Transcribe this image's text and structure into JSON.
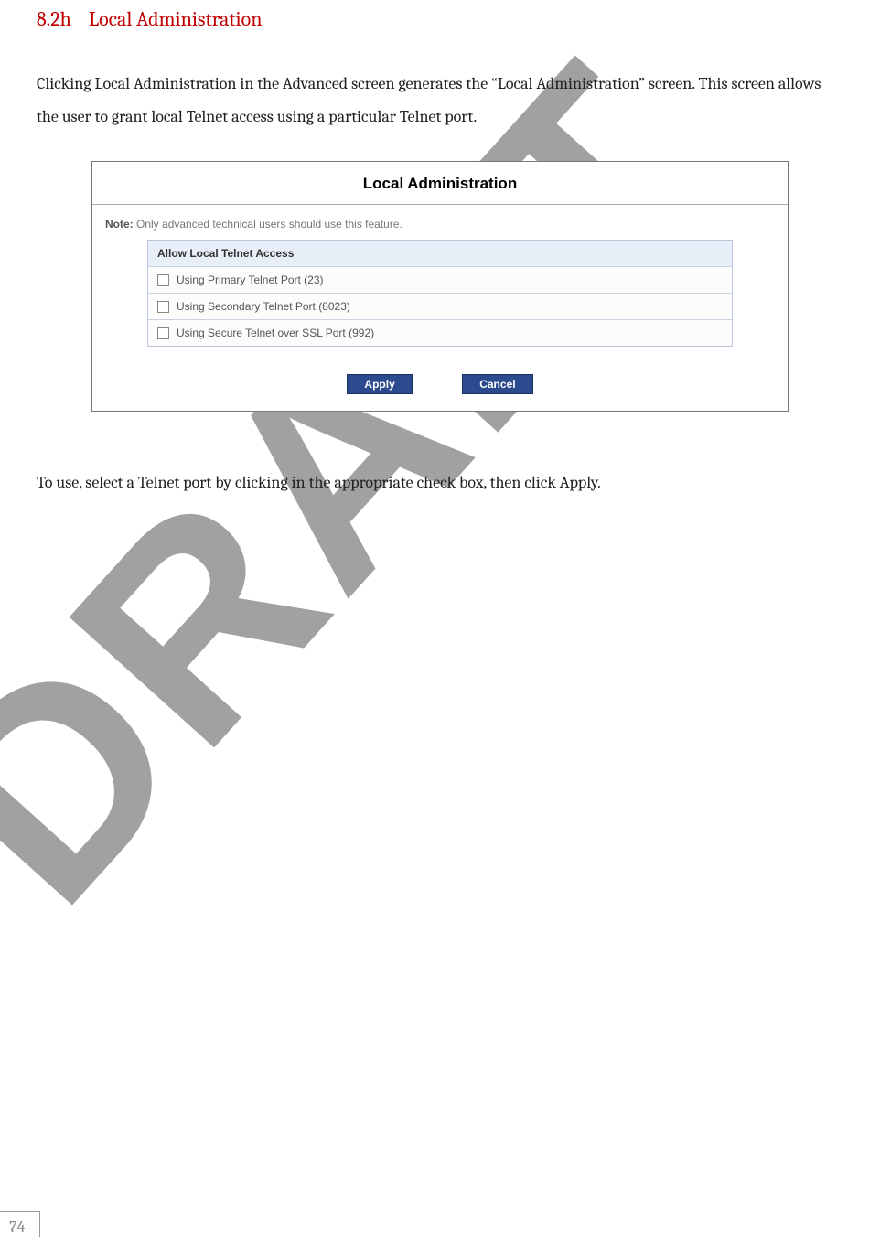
{
  "heading": {
    "number": "8.2h",
    "title": "Local Administration"
  },
  "paragraph1": "Clicking Local Administration in the Advanced screen generates the “Local Administration” screen. This screen allows the user to grant local Telnet access using a particular Telnet port.",
  "screenshot": {
    "title": "Local Administration",
    "noteLabel": "Note:",
    "noteText": " Only advanced technical users should use this feature.",
    "sectionHeader": "Allow Local Telnet Access",
    "options": [
      "Using Primary Telnet Port (23)",
      "Using Secondary Telnet Port (8023)",
      "Using Secure Telnet over SSL Port (992)"
    ],
    "applyLabel": "Apply",
    "cancelLabel": "Cancel"
  },
  "paragraph2": "To use, select a Telnet port by clicking in the appropriate check box, then click Apply.",
  "watermark": "DRAFT",
  "pageNumber": "74"
}
